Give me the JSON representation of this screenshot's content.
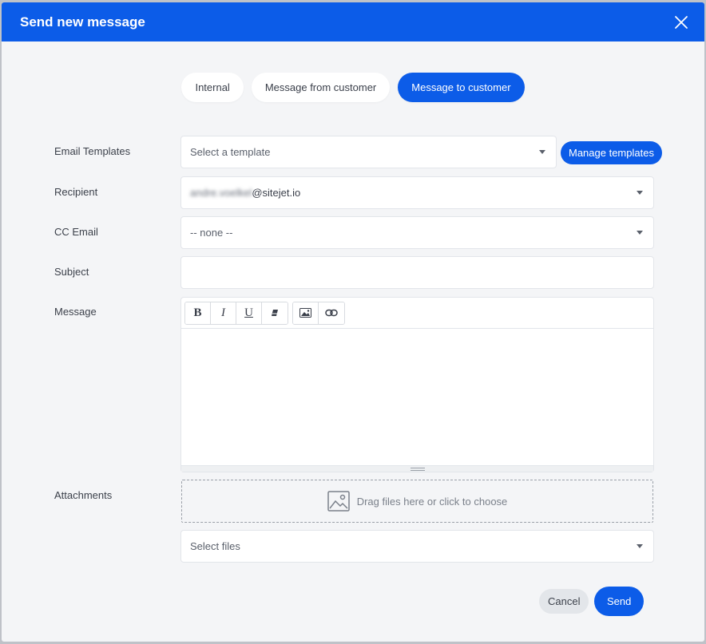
{
  "dialog": {
    "title": "Send new message"
  },
  "tabs": [
    {
      "label": "Internal",
      "active": false
    },
    {
      "label": "Message from customer",
      "active": false
    },
    {
      "label": "Message to customer",
      "active": true
    }
  ],
  "form": {
    "email_templates": {
      "label": "Email Templates",
      "placeholder": "Select a template"
    },
    "manage_templates_label": "Manage templates",
    "recipient": {
      "label": "Recipient",
      "value_blurred": "andre.voelkel",
      "value_domain": "@sitejet.io"
    },
    "cc_email": {
      "label": "CC Email",
      "value": "-- none --"
    },
    "subject": {
      "label": "Subject",
      "value": ""
    },
    "message": {
      "label": "Message",
      "value": ""
    },
    "attachments": {
      "label": "Attachments",
      "dropzone_text": "Drag files here or click to choose",
      "select_placeholder": "Select files"
    }
  },
  "toolbar": {
    "bold": "B",
    "italic": "I",
    "underline": "U"
  },
  "actions": {
    "cancel_label": "Cancel",
    "send_label": "Send"
  },
  "colors": {
    "accent": "#0c5ce8",
    "background": "#f4f5f7"
  },
  "icons": [
    "close-icon",
    "caret-down-icon",
    "eraser-icon",
    "image-icon",
    "link-icon",
    "image-placeholder-icon"
  ]
}
